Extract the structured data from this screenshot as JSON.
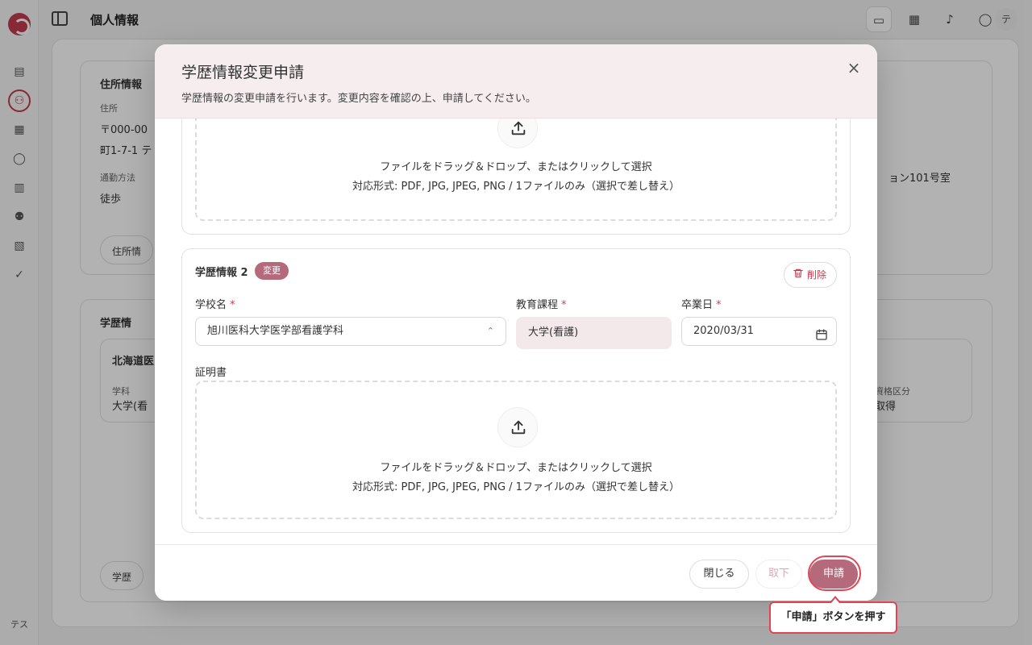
{
  "app": {
    "page_title": "個人情報",
    "sidebar_user_initials": "テス",
    "avatar_initial": "テ"
  },
  "background": {
    "address_section_title": "住所情報",
    "address_label": "住所",
    "address_line1": "〒000-00",
    "address_line2": "町1-7-1 テ",
    "commute_label": "通勤方法",
    "commute_value": "徒歩",
    "address_button": "住所情",
    "right_fragment": "ョン101号室",
    "education_section_title": "学歴情",
    "school_fragment": "北海道医",
    "faculty_label": "学科",
    "faculty_value": "大学(看",
    "right_label_fragment": "資格区分",
    "right_value_fragment": "取得",
    "education_button": "学歴"
  },
  "modal": {
    "title": "学歴情報変更申請",
    "description": "学歴情報の変更申請を行います。変更内容を確認の上、申請してください。",
    "close_glyph": "×",
    "dropzone_main": "ファイルをドラッグ＆ドロップ、またはクリックして選択",
    "dropzone_sub": "対応形式: PDF, JPG, JPEG, PNG / 1ファイルのみ（選択で差し替え）",
    "entry": {
      "title": "学歴情報 2",
      "badge": "変更",
      "delete_label": "削除",
      "school_label": "学校名",
      "school_value": "旭川医科大学医学部看護学科",
      "course_label": "教育課程",
      "course_value": "大学(看護)",
      "graduation_label": "卒業日",
      "graduation_value": "2020/03/31",
      "certificate_label": "証明書",
      "required_mark": "*"
    },
    "footer": {
      "close_label": "閉じる",
      "withdraw_label": "取下",
      "apply_label": "申請"
    }
  },
  "callout": {
    "text": "「申請」ボタンを押す"
  },
  "colors": {
    "accent": "#b56a7c",
    "brand": "#c23b4e",
    "highlight": "#e04455",
    "header_bg": "#f5edee"
  }
}
